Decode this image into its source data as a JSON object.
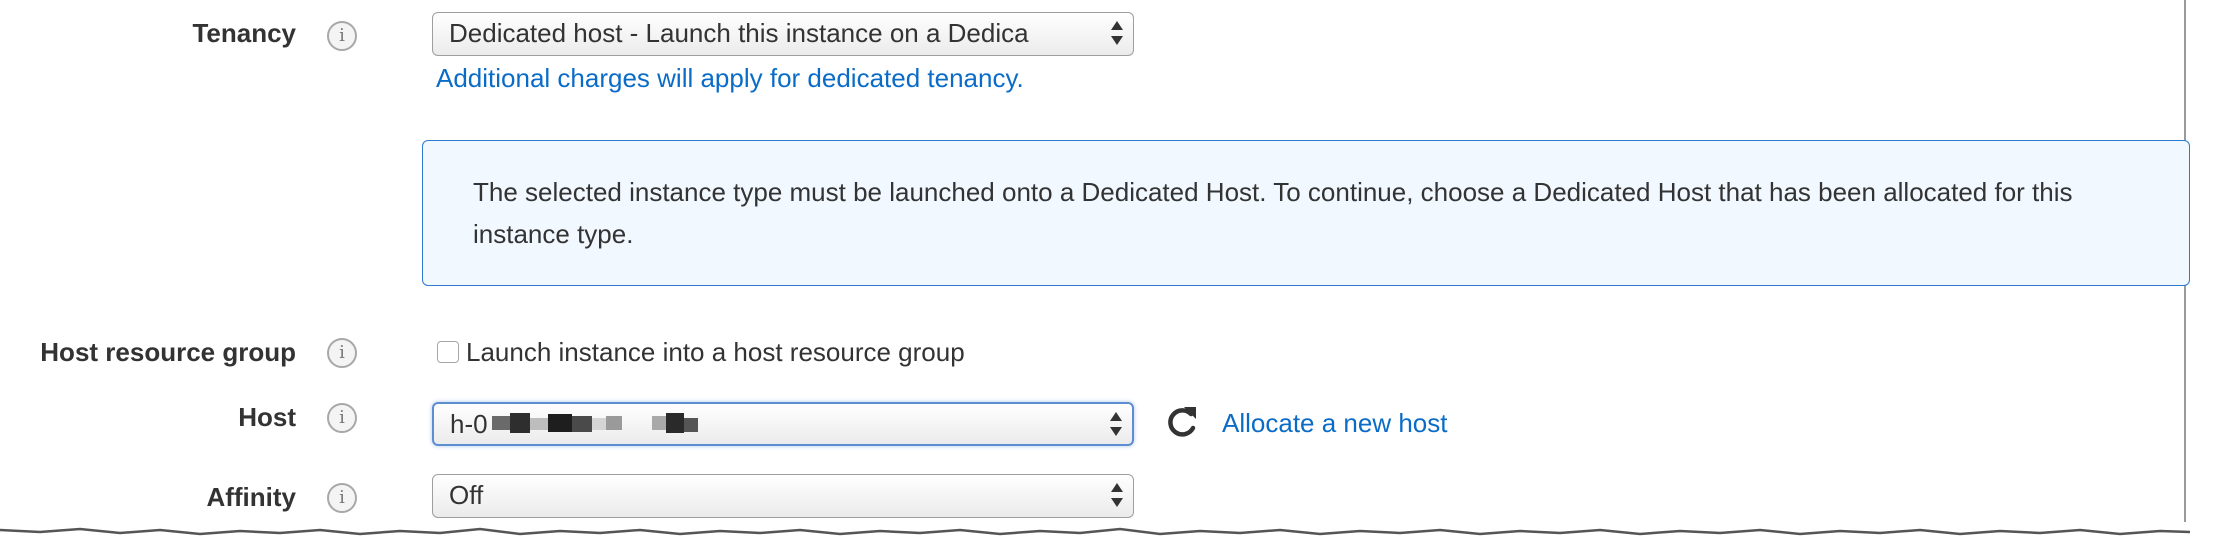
{
  "tenancy": {
    "label": "Tenancy",
    "selected": "Dedicated host - Launch this instance on a Dedica",
    "note_link": "Additional charges will apply for dedicated tenancy."
  },
  "notice": {
    "text": "The selected instance type must be launched onto a Dedicated Host. To continue, choose a Dedicated Host that has been allocated for this instance type."
  },
  "host_resource_group": {
    "label": "Host resource group",
    "checkbox_label": "Launch instance into a host resource group",
    "checked": false
  },
  "host": {
    "label": "Host",
    "selected": "h-0",
    "value_redacted": true,
    "refresh_icon": "refresh-icon",
    "allocate_link": "Allocate a new host"
  },
  "affinity": {
    "label": "Affinity",
    "selected": "Off"
  },
  "icons": {
    "info": "info-icon",
    "select_arrow": "updown-arrow-icon"
  },
  "colors": {
    "link": "#0b6cc8",
    "notice_border": "#2e7ad1",
    "notice_bg": "#f1f8ff",
    "focus_border": "#5d8ed1"
  }
}
